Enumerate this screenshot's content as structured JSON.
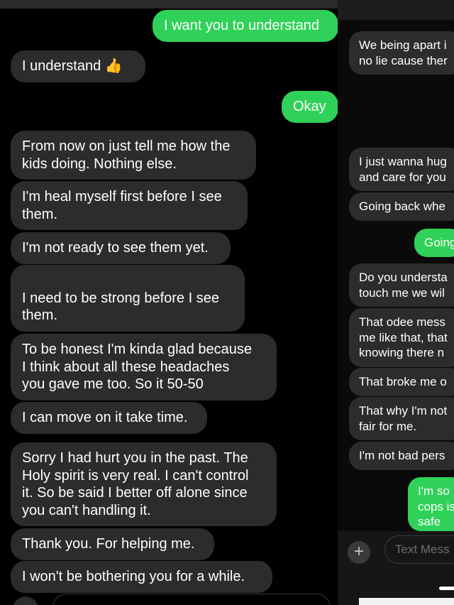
{
  "left_conversation": {
    "messages": [
      {
        "dir": "out",
        "text": "I want you to understand"
      },
      {
        "dir": "in",
        "text": "I understand 👍"
      },
      {
        "dir": "out",
        "text": "Okay"
      },
      {
        "dir": "in",
        "text": "From now on just tell me how the\nkids doing. Nothing else."
      },
      {
        "dir": "in",
        "text": "I'm heal myself first before I see\nthem."
      },
      {
        "dir": "in",
        "text": "I'm not ready to see them yet."
      },
      {
        "dir": "in",
        "text": "\nI need to be strong before I see\nthem."
      },
      {
        "dir": "in",
        "text": "To be honest I'm kinda glad because\nI think about all these headaches\nyou gave me too. So it 50-50"
      },
      {
        "dir": "in",
        "text": "I can move on it take time."
      },
      {
        "dir": "in",
        "text": "Sorry I had hurt you in the past. The\nHoly spirit is very real. I can't control\nit. So be said I better off alone since\nyou can't handling it."
      },
      {
        "dir": "in",
        "text": "Thank you. For helping me."
      },
      {
        "dir": "in",
        "text": "I won't be bothering you for a while."
      }
    ]
  },
  "right_conversation": {
    "messages": [
      {
        "dir": "in",
        "text": "We being apart i\nno lie cause ther"
      },
      {
        "dir": "in",
        "text": "I just wanna hug\nand care for you"
      },
      {
        "dir": "in",
        "text": "Going back whe"
      },
      {
        "dir": "out",
        "text": "Going"
      },
      {
        "dir": "in",
        "text": "Do you understa\ntouch me we wil"
      },
      {
        "dir": "in",
        "text": "That odee mess\nme like that, that\nknowing there n"
      },
      {
        "dir": "in",
        "text": "That broke me o"
      },
      {
        "dir": "in",
        "text": "That why I'm not\nfair for me."
      },
      {
        "dir": "in",
        "text": "I'm not bad pers"
      },
      {
        "dir": "out",
        "text": "I'm so\ncops is\nsafe"
      }
    ],
    "composer": {
      "placeholder": "Text Mess",
      "plus_icon": "plus-icon"
    }
  },
  "colors": {
    "incoming": "#2c2c2e",
    "outgoing": "#30d158",
    "background": "#000000"
  }
}
